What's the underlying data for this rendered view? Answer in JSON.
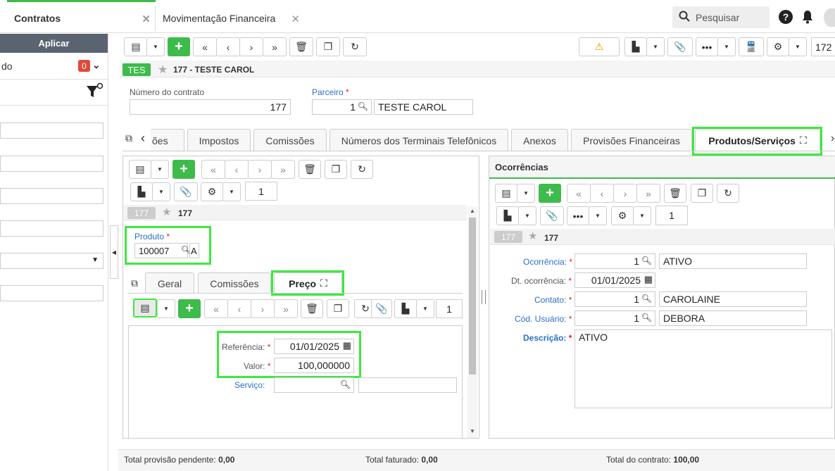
{
  "top_tabs": [
    {
      "label": "Contratos"
    },
    {
      "label": "Movimentação Financeira"
    }
  ],
  "search": {
    "placeholder": "Pesquisar"
  },
  "left": {
    "apply_label": "Aplicar",
    "filter_label": "do",
    "filter_count": "0"
  },
  "toolbar": {
    "record_number": "172"
  },
  "header": {
    "code": "TES",
    "title": "177 - TESTE CAROL"
  },
  "contract": {
    "number_label": "Número do contrato",
    "number_value": "177",
    "partner_label": "Parceiro",
    "partner_code": "1",
    "partner_name": "TESTE CAROL"
  },
  "tabs": [
    "ões",
    "Impostos",
    "Comissões",
    "Números dos Terminais Telefônicos",
    "Anexos",
    "Provisões Financeiras",
    "Produtos/Serviços"
  ],
  "products": {
    "page": "1",
    "badge": "177",
    "record": "177",
    "produto_label": "Produto",
    "produto_value": "100007",
    "produto_suffix": "A",
    "subtabs": [
      "Geral",
      "Comissões",
      "Preço"
    ],
    "sub_page": "1",
    "referencia_label": "Referência:",
    "referencia_value": "01/01/2025",
    "valor_label": "Valor:",
    "valor_value": "100,000000",
    "servico_label": "Serviço:"
  },
  "ocorrencias": {
    "title": "Ocorrências",
    "page": "1",
    "badge": "177",
    "record": "177",
    "ocorrencia_label": "Ocorrência:",
    "ocorrencia_code": "1",
    "ocorrencia_name": "ATIVO",
    "dt_label": "Dt. ocorrência:",
    "dt_value": "01/01/2025",
    "contato_label": "Contato:",
    "contato_code": "1",
    "contato_name": "CAROLAINE",
    "usuario_label": "Cód. Usuário:",
    "usuario_code": "1",
    "usuario_name": "DEBORA",
    "descricao_label": "Descrição:",
    "descricao_value": "ATIVO"
  },
  "footer": {
    "pendente_label": "Total provisão pendente:",
    "pendente_value": "0,00",
    "faturado_label": "Total faturado:",
    "faturado_value": "0,00",
    "contrato_label": "Total do contrato:",
    "contrato_value": "100,00"
  },
  "colors": {
    "accent": "#3dbb4b",
    "highlight": "#3ee83e",
    "link": "#2a6fc9"
  }
}
